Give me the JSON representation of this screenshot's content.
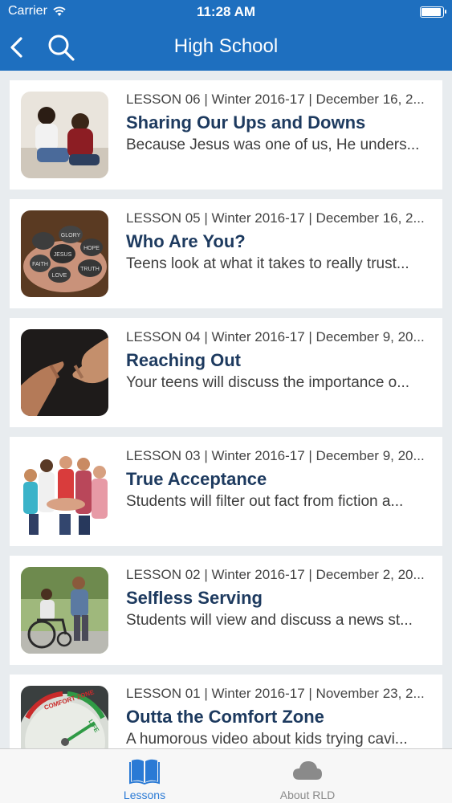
{
  "status_bar": {
    "carrier": "Carrier",
    "time": "11:28 AM",
    "battery_level": 0.95
  },
  "navbar": {
    "title": "High School",
    "back_icon": "chevron-left-icon",
    "search_icon": "search-icon"
  },
  "colors": {
    "header": "#1e6fbf",
    "title_text": "#1d3a5f",
    "tab_active": "#2a7ad5",
    "tab_inactive": "#8a8a8a"
  },
  "lessons": [
    {
      "meta": "LESSON 06 | Winter 2016-17 | December 16, 2...",
      "title": "Sharing Our Ups and Downs",
      "description": "Because Jesus was one of us, He unders..."
    },
    {
      "meta": "LESSON 05 | Winter 2016-17 | December 16, 2...",
      "title": "Who Are You?",
      "description": "Teens look at what it takes to really trust...",
      "stone_words": [
        "GLORY",
        "JESUS",
        "HOPE",
        "FAITH",
        "TRUTH",
        "LOVE"
      ]
    },
    {
      "meta": "LESSON 04 | Winter 2016-17 | December 9, 20...",
      "title": "Reaching Out",
      "description": "Your teens will discuss the importance o..."
    },
    {
      "meta": "LESSON 03 | Winter 2016-17 | December 9, 20...",
      "title": "True Acceptance",
      "description": "Students will filter out fact from fiction a..."
    },
    {
      "meta": "LESSON 02 | Winter 2016-17 | December 2, 20...",
      "title": "Selfless Serving",
      "description": "Students will view and discuss a news st..."
    },
    {
      "meta": "LESSON 01 | Winter 2016-17 | November 23, 2...",
      "title": "Outta the Comfort Zone",
      "description": "A humorous video about kids trying cavi...",
      "gauge_words": [
        "COMFORT ZONE",
        "LIFE"
      ]
    }
  ],
  "tabs": [
    {
      "label": "Lessons",
      "icon": "book-icon",
      "active": true
    },
    {
      "label": "About RLD",
      "icon": "cloud-icon",
      "active": false
    }
  ]
}
